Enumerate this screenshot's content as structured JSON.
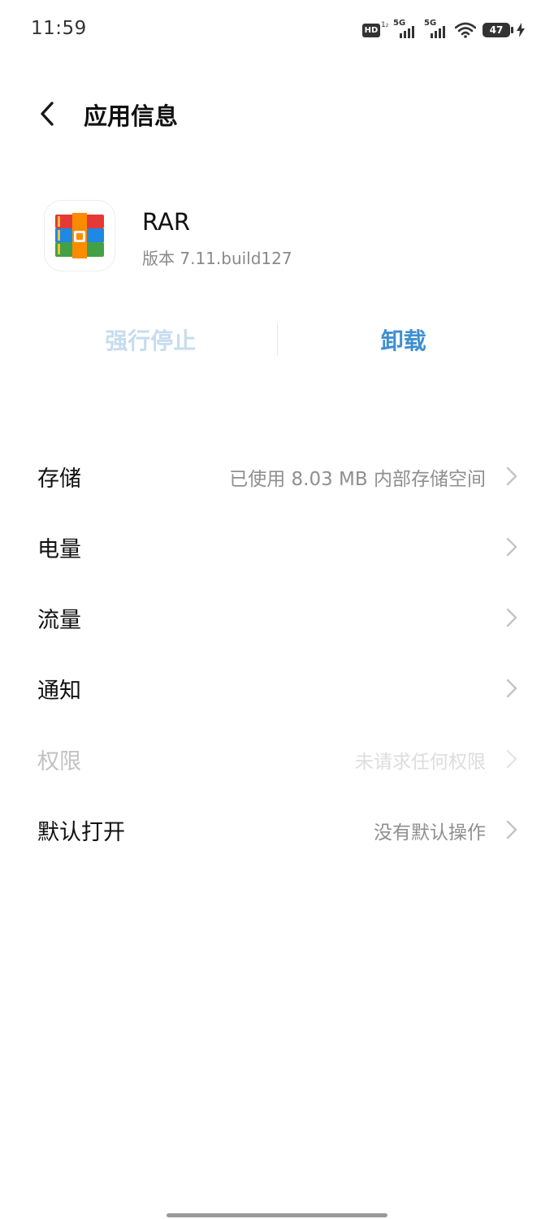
{
  "status_bar": {
    "time": "11:59",
    "hd_label": "HD",
    "hd_sub": "1₂",
    "sim1_net": "5G",
    "sim2_net": "5G",
    "battery": "47",
    "icons": [
      "hd-icon",
      "signal-icon",
      "signal-icon",
      "wifi-icon",
      "battery-icon",
      "charging-icon"
    ]
  },
  "header": {
    "title": "应用信息",
    "back_icon": "chevron-left-icon"
  },
  "app": {
    "name": "RAR",
    "version": "版本 7.11.build127",
    "icon": "rar-archive-icon",
    "icon_colors": [
      "#e53935",
      "#fbc02d",
      "#1e88e5",
      "#43a047",
      "#fb8c00"
    ]
  },
  "actions": {
    "force_stop": "强行停止",
    "uninstall": "卸载",
    "accent_color": "#3d8fd1"
  },
  "settings": {
    "items": [
      {
        "label": "存储",
        "value": "已使用 8.03 MB 内部存储空间",
        "enabled": true
      },
      {
        "label": "电量",
        "value": "",
        "enabled": true
      },
      {
        "label": "流量",
        "value": "",
        "enabled": true
      },
      {
        "label": "通知",
        "value": "",
        "enabled": true
      },
      {
        "label": "权限",
        "value": "未请求任何权限",
        "enabled": false
      },
      {
        "label": "默认打开",
        "value": "没有默认操作",
        "enabled": true
      }
    ]
  }
}
